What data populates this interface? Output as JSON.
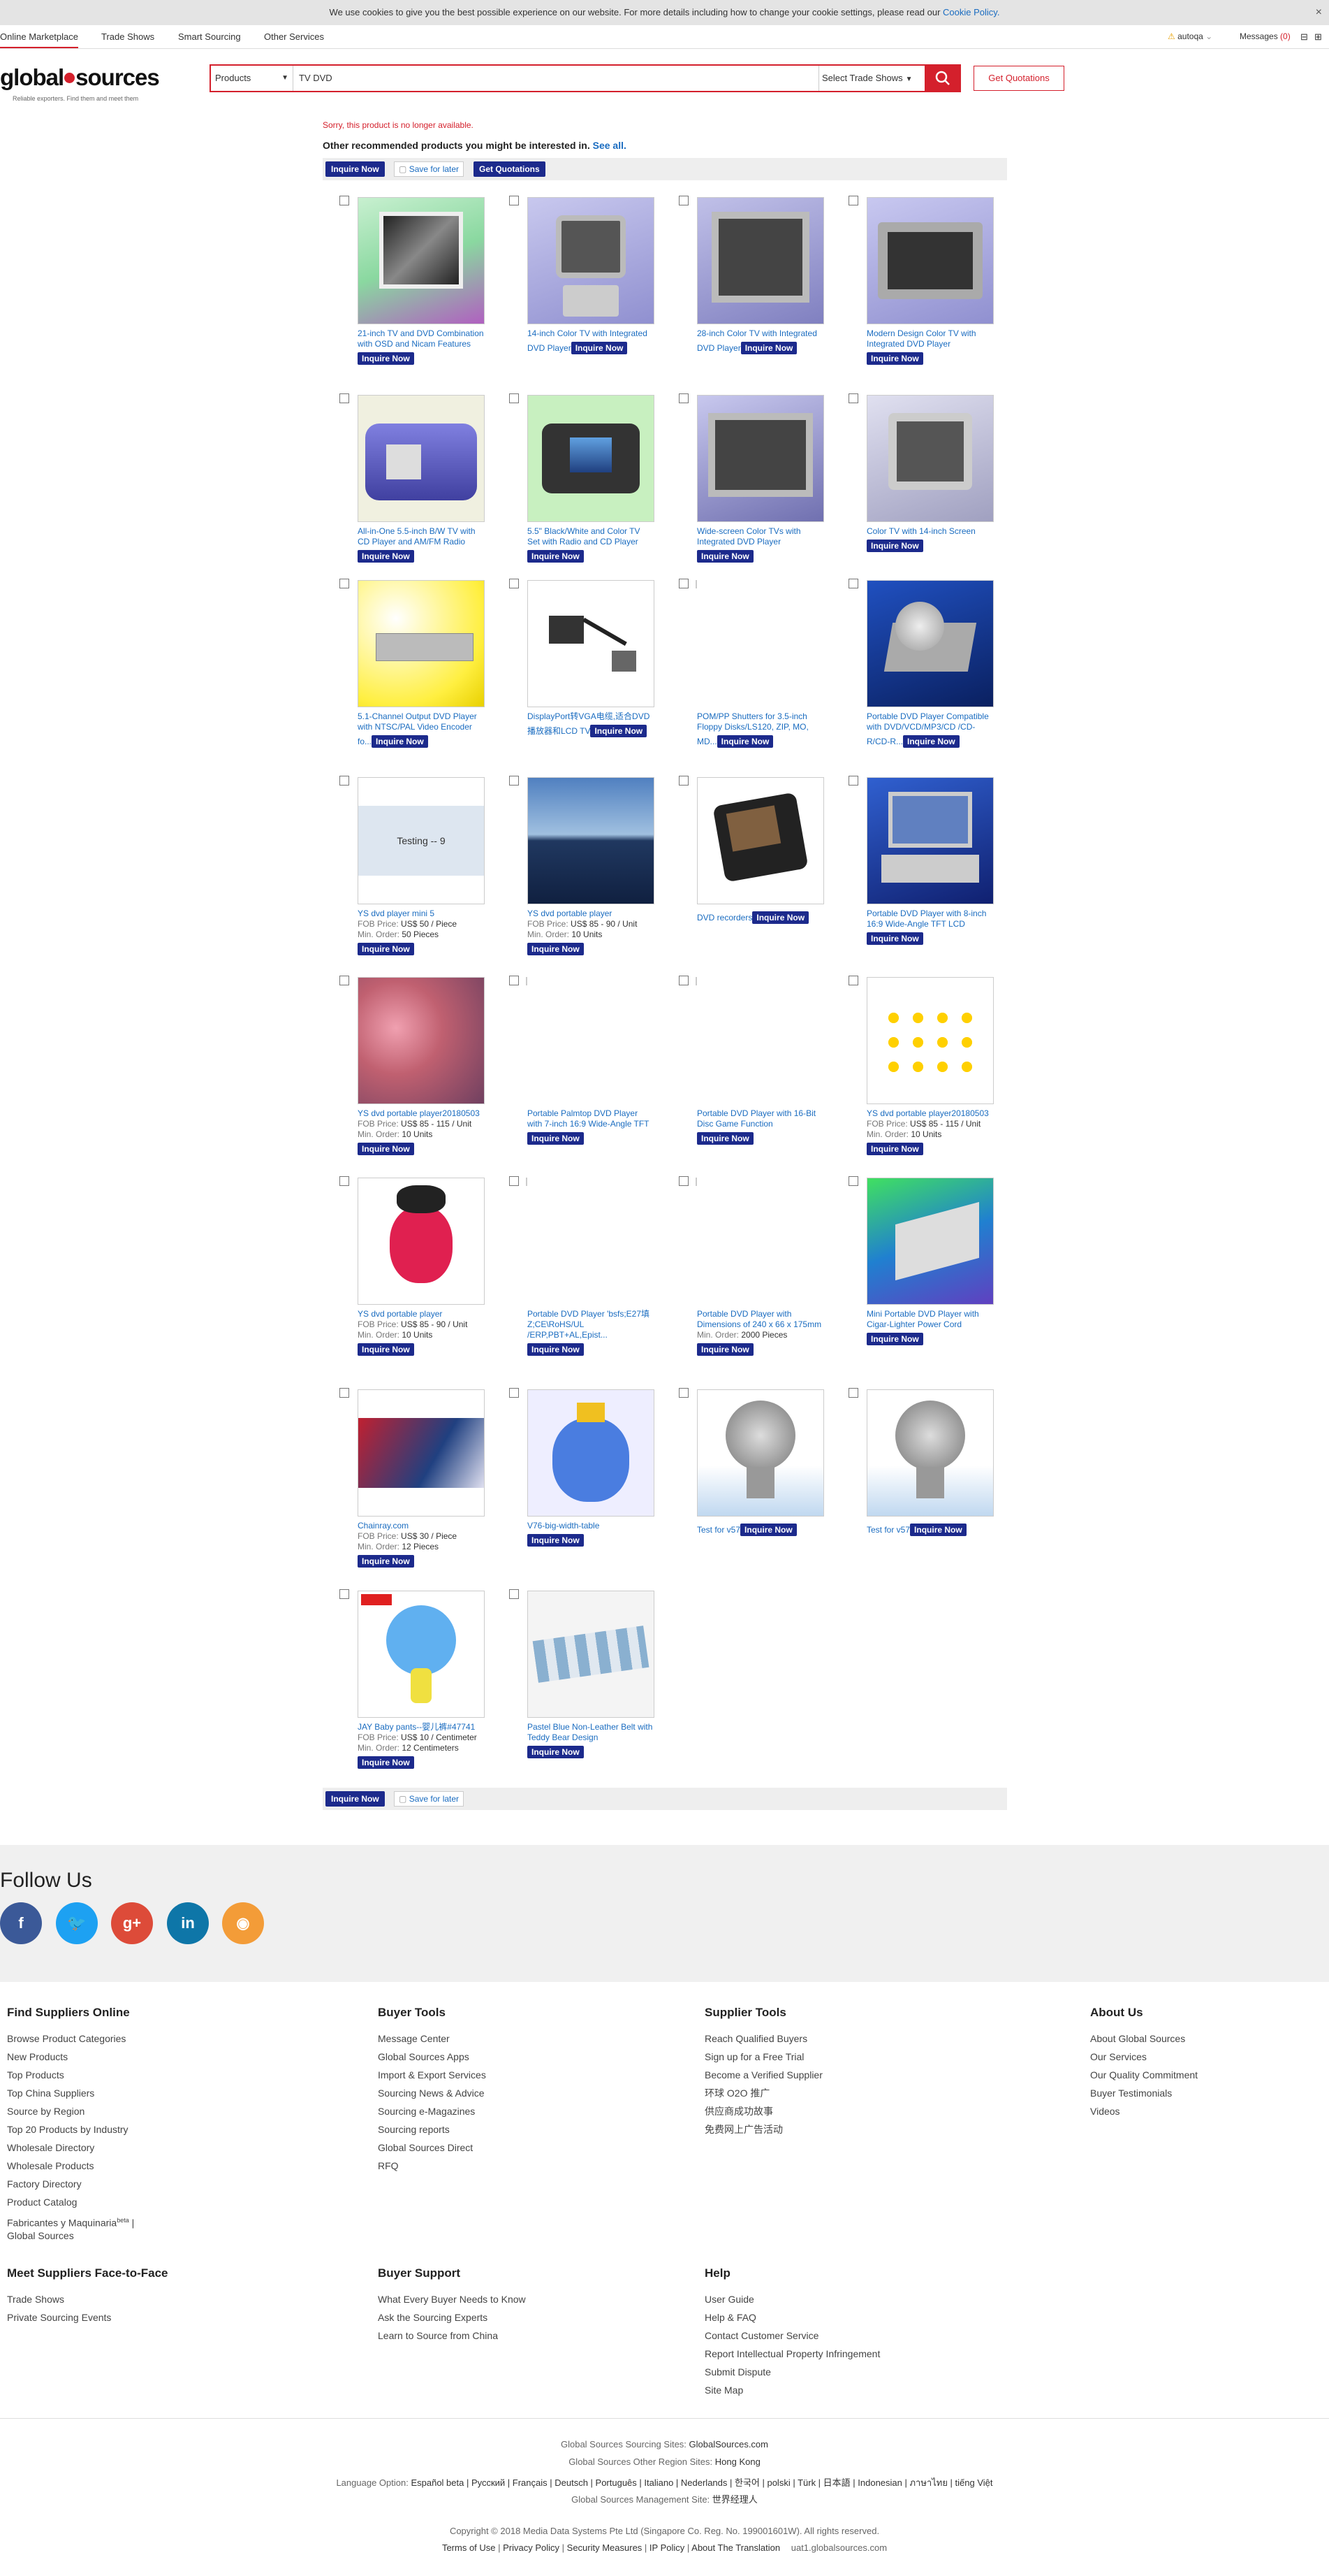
{
  "cookie": {
    "text": "We use cookies to give you the best possible experience on our website. For more details including how to change your cookie settings, please read our",
    "link": "Cookie Policy.",
    "close": "×"
  },
  "topnav": {
    "items": [
      "Online Marketplace",
      "Trade Shows",
      "Smart Sourcing",
      "Other Services"
    ],
    "user": "autoqa",
    "messages": "Messages",
    "msg_count": "(0)"
  },
  "header": {
    "logo_a": "global",
    "logo_b": "sources",
    "tagline": "Reliable exporters. Find them and meet them",
    "category": "Products",
    "keyword": "TV DVD",
    "trade_shows": "Select Trade Shows",
    "quotations": "Get Quotations"
  },
  "main": {
    "no_longer": "Sorry, this product is no longer available.",
    "other": "Other recommended products you might be interested in.",
    "see_all": "See all.",
    "inquire": "Inquire Now",
    "save": "Save for later",
    "get_quot": "Get Quotations",
    "fob_label": "FOB Price:",
    "min_label": "Min. Order:"
  },
  "products": [
    {
      "title": "21-inch TV and DVD Combination with OSD and Nicam Features",
      "img": "tv-combo"
    },
    {
      "title": "14-inch Color TV with Integrated DVD Player",
      "img": "tv-gray"
    },
    {
      "title": "28-inch Color TV with Integrated DVD Player",
      "img": "tv-flat"
    },
    {
      "title": "Modern Design Color TV with Integrated DVD Player",
      "img": "tv-silver"
    },
    {
      "title": "All-in-One 5.5-inch B/W TV with CD Player and AM/FM Radio",
      "img": "radio-blue"
    },
    {
      "title": "5.5\" Black/White and Color TV Set with Radio and CD Player",
      "img": "radio-green"
    },
    {
      "title": "Wide-screen Color TVs with Integrated DVD Player",
      "img": "tv-wide"
    },
    {
      "title": "Color TV with 14-inch Screen",
      "img": "tv-small"
    },
    {
      "title": "5.1-Channel Output DVD Player with NTSC/PAL Video Encoder fo...",
      "img": "dvd-yellow"
    },
    {
      "title": "DisplayPort转VGA电缆,适合DVD播放器和LCD TV",
      "img": "cable"
    },
    {
      "title": "POM/PP Shutters for 3.5-inch Floppy Disks/LS120, ZIP, MO, MD...",
      "img": "none"
    },
    {
      "title": "Portable DVD Player Compatible with DVD/VCD/MP3/CD /CD-R/CD-R...",
      "img": "dvd-disc"
    },
    {
      "title": "YS dvd player mini 5",
      "img": "testing",
      "fob": "US$ 50",
      "fob_unit": "/ Piece",
      "min": "50 Pieces"
    },
    {
      "title": "YS dvd portable player",
      "img": "sea",
      "fob": "US$ 85 - 90",
      "fob_unit": "/ Unit",
      "min": "10 Units"
    },
    {
      "title": "DVD recorders",
      "img": "mp4"
    },
    {
      "title": "Portable DVD Player with 8-inch 16:9 Wide-Angle TFT LCD",
      "img": "laptop-dvd"
    },
    {
      "title": "YS dvd portable player20180503",
      "img": "bokeh",
      "fob": "US$ 85 - 115",
      "fob_unit": "/ Unit",
      "min": "10 Units"
    },
    {
      "title": "Portable Palmtop DVD Player with 7-inch 16:9 Wide-Angle TFT",
      "img": "none"
    },
    {
      "title": "Portable DVD Player with 16-Bit Disc Game Function",
      "img": "none"
    },
    {
      "title": "YS dvd portable player20180503",
      "img": "ducks",
      "fob": "US$ 85 - 115",
      "fob_unit": "/ Unit",
      "min": "10 Units"
    },
    {
      "title": "YS dvd portable player",
      "img": "ladybug",
      "fob": "US$ 85 - 90",
      "fob_unit": "/ Unit",
      "min": "10 Units"
    },
    {
      "title": "Portable DVD Player 'bsfs;E27填Z;CE\\RoHS/UL /ERP,PBT+AL,Epist...",
      "img": "none"
    },
    {
      "title": "Portable DVD Player with Dimensions of 240 x 66 x 175mm",
      "img": "none",
      "min": "2000 Pieces"
    },
    {
      "title": "Mini Portable DVD Player with Cigar-Lighter Power Cord",
      "img": "mini-dvd"
    },
    {
      "title": "Chainray.com",
      "img": "spider",
      "fob": "US$ 30",
      "fob_unit": "/ Piece",
      "min": "12 Pieces"
    },
    {
      "title": "V76-big-width-table",
      "img": "elephant"
    },
    {
      "title": "Test for v57",
      "img": "lamp"
    },
    {
      "title": "Test for v57",
      "img": "lamp"
    },
    {
      "title": "JAY Baby pants--婴儿裤#47741",
      "img": "teether",
      "fob": "US$ 10",
      "fob_unit": "/ Centimeter",
      "min": "12 Centimeters"
    },
    {
      "title": "Pastel Blue Non-Leather Belt with Teddy Bear Design",
      "img": "belt"
    }
  ],
  "testing_text": "Testing -- 9",
  "follow": {
    "title": "Follow Us",
    "icons": [
      "facebook-icon",
      "twitter-icon",
      "google-plus-icon",
      "linkedin-icon",
      "rss-icon"
    ],
    "colors": [
      "#3b5998",
      "#1da1f2",
      "#dd4b39",
      "#0e76a8",
      "#f39c38"
    ]
  },
  "footer": {
    "cols": [
      {
        "title": "Find Suppliers Online",
        "links": [
          "Browse Product Categories",
          "New Products",
          "Top Products",
          "Top China Suppliers",
          "Source by Region",
          "Top 20 Products by Industry",
          "Wholesale Directory",
          "Wholesale Products",
          "Factory Directory",
          "Product Catalog",
          "Fabricantes y Maquinaria",
          "Global Sources"
        ]
      },
      {
        "title": "Buyer Tools",
        "links": [
          "Message Center",
          "Global Sources Apps",
          "Import & Export Services",
          "Sourcing News & Advice",
          "Sourcing e-Magazines",
          "Sourcing reports",
          "Global Sources Direct",
          "RFQ"
        ]
      },
      {
        "title": "Supplier Tools",
        "links": [
          "Reach Qualified Buyers",
          "Sign up for a Free Trial",
          "Become a Verified Supplier",
          "环球 O2O 推广",
          "供应商成功故事",
          "免费网上广告活动"
        ]
      },
      {
        "title": "About Us",
        "links": [
          "About Global Sources",
          "Our Services",
          "Our Quality Commitment",
          "Buyer Testimonials",
          "Videos"
        ]
      },
      {
        "title": "Meet Suppliers Face-to-Face",
        "links": [
          "Trade Shows",
          "Private Sourcing Events"
        ]
      },
      {
        "title": "Buyer Support",
        "links": [
          "What Every Buyer Needs to Know",
          "Ask the Sourcing Experts",
          "Learn to Source from China"
        ]
      },
      {
        "title": "Help",
        "links": [
          "User Guide",
          "Help & FAQ",
          "Contact Customer Service",
          "Report Intellectual Property Infringement",
          "Submit Dispute",
          "Site Map"
        ]
      }
    ],
    "beta": "beta",
    "sites_label": "Global Sources Sourcing Sites:",
    "sites_value": "GlobalSources.com",
    "region_label": "Global Sources Other Region Sites:",
    "region_value": "Hong Kong",
    "lang_label": "Language Option:",
    "langs": "Español beta | Русский | Français | Deutsch | Português | Italiano | Nederlands | 한국어 | polski | Türk | 日本語 | Indonesian | ภาษาไทย | tiếng Việt",
    "mgmt_label": "Global Sources Management Site:",
    "mgmt_value": "世界经理人",
    "copyright": "Copyright © 2018 Media Data Systems Pte Ltd (Singapore Co. Reg. No. 199001601W). All rights reserved.",
    "bottom_links": [
      "Terms of Use",
      "Privacy Policy",
      "Security Measures",
      "IP Policy",
      "About The Translation"
    ],
    "server": "uat1.globalsources.com"
  }
}
